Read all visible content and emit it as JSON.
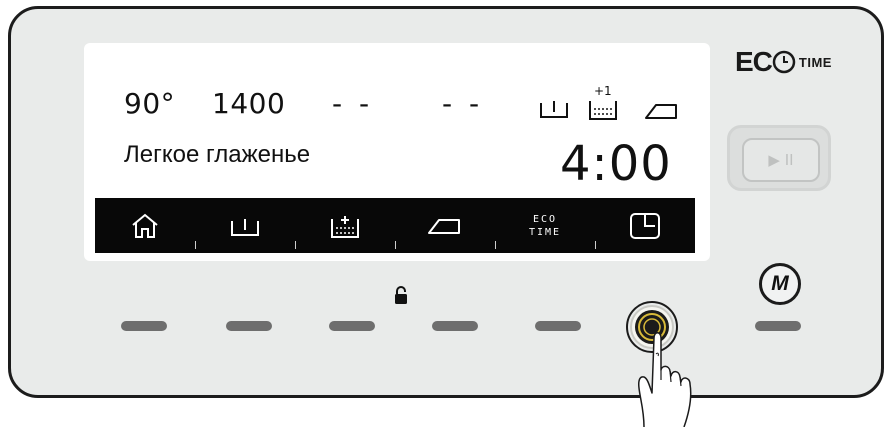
{
  "display": {
    "temperature": "90°",
    "spin_speed": "1400",
    "option_a": "- -",
    "option_b": "- -",
    "extra_rinse_badge": "+1",
    "program_name": "Легкое глаженье",
    "remaining_time": "4:00"
  },
  "menu": {
    "items": [
      {
        "icon": "home-icon"
      },
      {
        "icon": "tub-icon"
      },
      {
        "icon": "extra-rinse-icon"
      },
      {
        "icon": "iron-icon"
      },
      {
        "label_line1": "ECO",
        "label_line2": "TIME"
      },
      {
        "icon": "delay-timer-icon"
      }
    ]
  },
  "brand": {
    "eco": "EC",
    "time": "TIME"
  },
  "controls": {
    "start_pause_icon": "▶ II",
    "m_button_label": "M",
    "lock_icon": "padlock-icon"
  },
  "colors": {
    "panel": "#e9ebea",
    "menubar": "#080808",
    "press_ring": "#d8ba3a"
  }
}
